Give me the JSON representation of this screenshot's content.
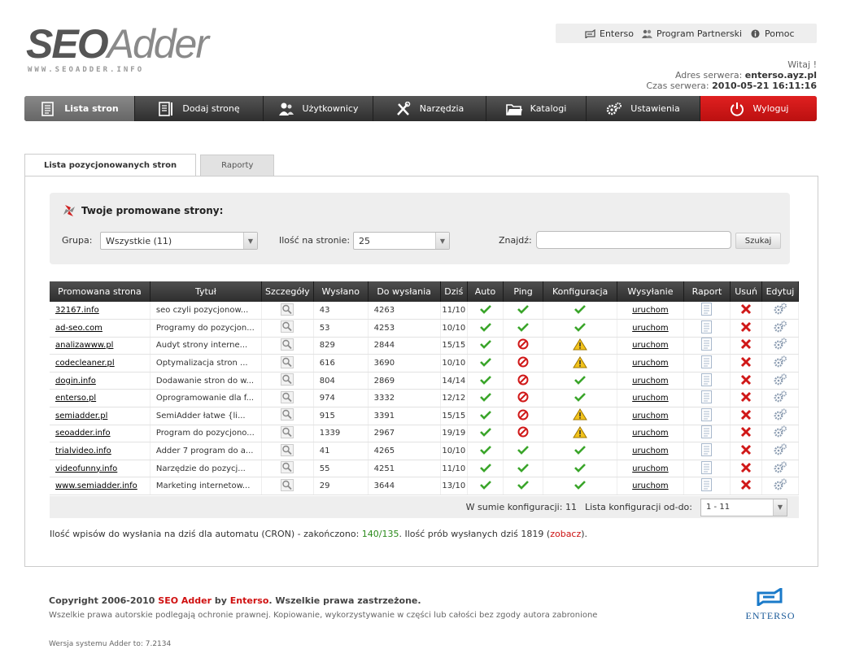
{
  "logo": {
    "part1": "SEO",
    "part2": "Adder",
    "url": "WWW.SEOADDER.INFO"
  },
  "toplinks": [
    {
      "label": "Enterso",
      "icon": "enterso-icon"
    },
    {
      "label": "Program Partnerski",
      "icon": "partners-icon"
    },
    {
      "label": "Pomoc",
      "icon": "help-icon"
    }
  ],
  "server": {
    "greeting": "Witaj !",
    "address_label": "Adres serwera:",
    "address": "enterso.ayz.pl",
    "time_label": "Czas serwera:",
    "time": "2010-05-21 16:11:16"
  },
  "menu": [
    {
      "label": "Lista stron",
      "icon": "list-icon",
      "active": true
    },
    {
      "label": "Dodaj stronę",
      "icon": "add-page-icon"
    },
    {
      "label": "Użytkownicy",
      "icon": "users-icon"
    },
    {
      "label": "Narzędzia",
      "icon": "tools-icon"
    },
    {
      "label": "Katalogi",
      "icon": "folder-icon"
    },
    {
      "label": "Ustawienia",
      "icon": "gears-icon"
    },
    {
      "label": "Wyloguj",
      "icon": "power-icon"
    }
  ],
  "tabs": [
    "Lista pozycjonowanych stron",
    "Raporty"
  ],
  "filter": {
    "title": "Twoje promowane strony:",
    "group_label": "Grupa:",
    "group_value": "Wszystkie (11)",
    "perpage_label": "Ilość na stronie:",
    "perpage_value": "25",
    "find_label": "Znajdź:",
    "find_value": "",
    "search_button": "Szukaj"
  },
  "table": {
    "headers": [
      "Promowana strona",
      "Tytuł",
      "Szczegóły",
      "Wysłano",
      "Do wysłania",
      "Dziś",
      "Auto",
      "Ping",
      "Konfiguracja",
      "Wysyłanie",
      "Raport",
      "Usuń",
      "Edytuj"
    ],
    "send_link": "uruchom",
    "rows": [
      {
        "site": "32167.info",
        "title": "seo czyli pozycjonow...",
        "sent": "43",
        "to_send": "4263",
        "today": "11/10",
        "auto": "ok",
        "ping": "ok",
        "config": "ok"
      },
      {
        "site": "ad-seo.com",
        "title": "Programy do pozycjon...",
        "sent": "53",
        "to_send": "4253",
        "today": "10/10",
        "auto": "ok",
        "ping": "ok",
        "config": "ok"
      },
      {
        "site": "analizawww.pl",
        "title": "Audyt strony interne...",
        "sent": "829",
        "to_send": "2844",
        "today": "15/15",
        "auto": "ok",
        "ping": "no",
        "config": "warn"
      },
      {
        "site": "codecleaner.pl",
        "title": "Optymalizacja stron ...",
        "sent": "616",
        "to_send": "3690",
        "today": "10/10",
        "auto": "ok",
        "ping": "no",
        "config": "warn"
      },
      {
        "site": "dogin.info",
        "title": "Dodawanie stron do w...",
        "sent": "804",
        "to_send": "2869",
        "today": "14/14",
        "auto": "ok",
        "ping": "no",
        "config": "ok"
      },
      {
        "site": "enterso.pl",
        "title": "Oprogramowanie dla f...",
        "sent": "974",
        "to_send": "3332",
        "today": "12/12",
        "auto": "ok",
        "ping": "no",
        "config": "ok"
      },
      {
        "site": "semiadder.pl",
        "title": "SemiAdder łatwe {li...",
        "sent": "915",
        "to_send": "3391",
        "today": "15/15",
        "auto": "ok",
        "ping": "no",
        "config": "warn"
      },
      {
        "site": "seoadder.info",
        "title": "Program do pozycjono...",
        "sent": "1339",
        "to_send": "2967",
        "today": "19/19",
        "auto": "ok",
        "ping": "no",
        "config": "warn"
      },
      {
        "site": "trialvideo.info",
        "title": "Adder 7 program do a...",
        "sent": "41",
        "to_send": "4265",
        "today": "10/10",
        "auto": "ok",
        "ping": "ok",
        "config": "ok"
      },
      {
        "site": "videofunny.info",
        "title": "Narzędzie do pozycj...",
        "sent": "55",
        "to_send": "4251",
        "today": "11/10",
        "auto": "ok",
        "ping": "ok",
        "config": "ok"
      },
      {
        "site": "www.semiadder.info",
        "title": "Marketing internetow...",
        "sent": "29",
        "to_send": "3644",
        "today": "13/10",
        "auto": "ok",
        "ping": "ok",
        "config": "ok"
      }
    ]
  },
  "summary": {
    "total_label": "W sumie konfiguracji: 11",
    "range_label": "Lista konfiguracji od-do:",
    "range_value": "1 - 11"
  },
  "cron": {
    "text1": "Ilość wpisów do wysłania na dziś dla automatu (CRON) - zakończono: ",
    "done": "140/135",
    "text2": ". Ilość prób wysłanych dziś 1819 (",
    "link": "zobacz",
    "text3": ")."
  },
  "footer": {
    "copy_prefix": "Copyright 2006-2010 ",
    "brand": "SEO Adder",
    "by": " by ",
    "company": "Enterso",
    "rights": ". Wszelkie prawa zastrzeżone.",
    "notice": "Wszelkie prawa autorskie podlegają ochronie prawnej. Kopiowanie, wykorzystywanie w części lub całości bez zgody autora zabronione",
    "version": "Wersja systemu Adder to: 7.2134",
    "enterso_logo_text": "ENTERSO"
  }
}
